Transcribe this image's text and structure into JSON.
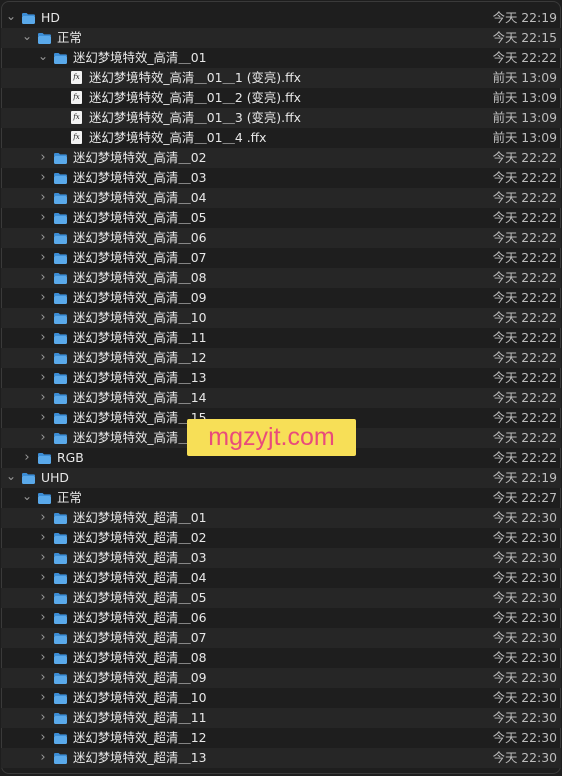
{
  "rows": [
    {
      "name": "HD",
      "date": "今天 22:19",
      "type": "folder",
      "level": 0,
      "expanded": true
    },
    {
      "name": "正常",
      "date": "今天 22:15",
      "type": "folder",
      "level": 1,
      "expanded": true
    },
    {
      "name": "迷幻梦境特效_高清＿01",
      "date": "今天 22:22",
      "type": "folder",
      "level": 2,
      "expanded": true
    },
    {
      "name": "迷幻梦境特效_高清＿01＿1 (变亮).ffx",
      "date": "前天 13:09",
      "type": "file",
      "level": 3
    },
    {
      "name": "迷幻梦境特效_高清＿01＿2 (变亮).ffx",
      "date": "前天 13:09",
      "type": "file",
      "level": 3
    },
    {
      "name": "迷幻梦境特效_高清＿01＿3 (变亮).ffx",
      "date": "前天 13:09",
      "type": "file",
      "level": 3
    },
    {
      "name": "迷幻梦境特效_高清＿01＿4 .ffx",
      "date": "前天 13:09",
      "type": "file",
      "level": 3
    },
    {
      "name": "迷幻梦境特效_高清＿02",
      "date": "今天 22:22",
      "type": "folder",
      "level": 2,
      "expanded": false
    },
    {
      "name": "迷幻梦境特效_高清＿03",
      "date": "今天 22:22",
      "type": "folder",
      "level": 2,
      "expanded": false
    },
    {
      "name": "迷幻梦境特效_高清＿04",
      "date": "今天 22:22",
      "type": "folder",
      "level": 2,
      "expanded": false
    },
    {
      "name": "迷幻梦境特效_高清＿05",
      "date": "今天 22:22",
      "type": "folder",
      "level": 2,
      "expanded": false
    },
    {
      "name": "迷幻梦境特效_高清＿06",
      "date": "今天 22:22",
      "type": "folder",
      "level": 2,
      "expanded": false
    },
    {
      "name": "迷幻梦境特效_高清＿07",
      "date": "今天 22:22",
      "type": "folder",
      "level": 2,
      "expanded": false
    },
    {
      "name": "迷幻梦境特效_高清＿08",
      "date": "今天 22:22",
      "type": "folder",
      "level": 2,
      "expanded": false
    },
    {
      "name": "迷幻梦境特效_高清＿09",
      "date": "今天 22:22",
      "type": "folder",
      "level": 2,
      "expanded": false
    },
    {
      "name": "迷幻梦境特效_高清＿10",
      "date": "今天 22:22",
      "type": "folder",
      "level": 2,
      "expanded": false
    },
    {
      "name": "迷幻梦境特效_高清＿11",
      "date": "今天 22:22",
      "type": "folder",
      "level": 2,
      "expanded": false
    },
    {
      "name": "迷幻梦境特效_高清＿12",
      "date": "今天 22:22",
      "type": "folder",
      "level": 2,
      "expanded": false
    },
    {
      "name": "迷幻梦境特效_高清＿13",
      "date": "今天 22:22",
      "type": "folder",
      "level": 2,
      "expanded": false
    },
    {
      "name": "迷幻梦境特效_高清＿14",
      "date": "今天 22:22",
      "type": "folder",
      "level": 2,
      "expanded": false
    },
    {
      "name": "迷幻梦境特效_高清＿15",
      "date": "今天 22:22",
      "type": "folder",
      "level": 2,
      "expanded": false
    },
    {
      "name": "迷幻梦境特效_高清＿16",
      "date": "今天 22:22",
      "type": "folder",
      "level": 2,
      "expanded": false
    },
    {
      "name": "RGB",
      "date": "今天 22:22",
      "type": "folder",
      "level": 1,
      "expanded": false
    },
    {
      "name": "UHD",
      "date": "今天 22:19",
      "type": "folder",
      "level": 0,
      "expanded": true
    },
    {
      "name": "正常",
      "date": "今天 22:27",
      "type": "folder",
      "level": 1,
      "expanded": true
    },
    {
      "name": "迷幻梦境特效_超清＿01",
      "date": "今天 22:30",
      "type": "folder",
      "level": 2,
      "expanded": false
    },
    {
      "name": "迷幻梦境特效_超清＿02",
      "date": "今天 22:30",
      "type": "folder",
      "level": 2,
      "expanded": false
    },
    {
      "name": "迷幻梦境特效_超清＿03",
      "date": "今天 22:30",
      "type": "folder",
      "level": 2,
      "expanded": false
    },
    {
      "name": "迷幻梦境特效_超清＿04",
      "date": "今天 22:30",
      "type": "folder",
      "level": 2,
      "expanded": false
    },
    {
      "name": "迷幻梦境特效_超清＿05",
      "date": "今天 22:30",
      "type": "folder",
      "level": 2,
      "expanded": false
    },
    {
      "name": "迷幻梦境特效_超清＿06",
      "date": "今天 22:30",
      "type": "folder",
      "level": 2,
      "expanded": false
    },
    {
      "name": "迷幻梦境特效_超清＿07",
      "date": "今天 22:30",
      "type": "folder",
      "level": 2,
      "expanded": false
    },
    {
      "name": "迷幻梦境特效_超清＿08",
      "date": "今天 22:30",
      "type": "folder",
      "level": 2,
      "expanded": false
    },
    {
      "name": "迷幻梦境特效_超清＿09",
      "date": "今天 22:30",
      "type": "folder",
      "level": 2,
      "expanded": false
    },
    {
      "name": "迷幻梦境特效_超清＿10",
      "date": "今天 22:30",
      "type": "folder",
      "level": 2,
      "expanded": false
    },
    {
      "name": "迷幻梦境特效_超清＿11",
      "date": "今天 22:30",
      "type": "folder",
      "level": 2,
      "expanded": false
    },
    {
      "name": "迷幻梦境特效_超清＿12",
      "date": "今天 22:30",
      "type": "folder",
      "level": 2,
      "expanded": false
    },
    {
      "name": "迷幻梦境特效_超清＿13",
      "date": "今天 22:30",
      "type": "folder",
      "level": 2,
      "expanded": false
    }
  ],
  "watermark": {
    "text": "mgzyjt.com",
    "bg_color": "#f7df57",
    "text_color": "#e94b7b"
  },
  "colors": {
    "background": "#1e1e1e",
    "row_alt": "#262626",
    "folder": "#5aa9ea",
    "folder_dark": "#3b8dd6",
    "text": "#e8e8e8",
    "date": "#bdbdbd"
  }
}
